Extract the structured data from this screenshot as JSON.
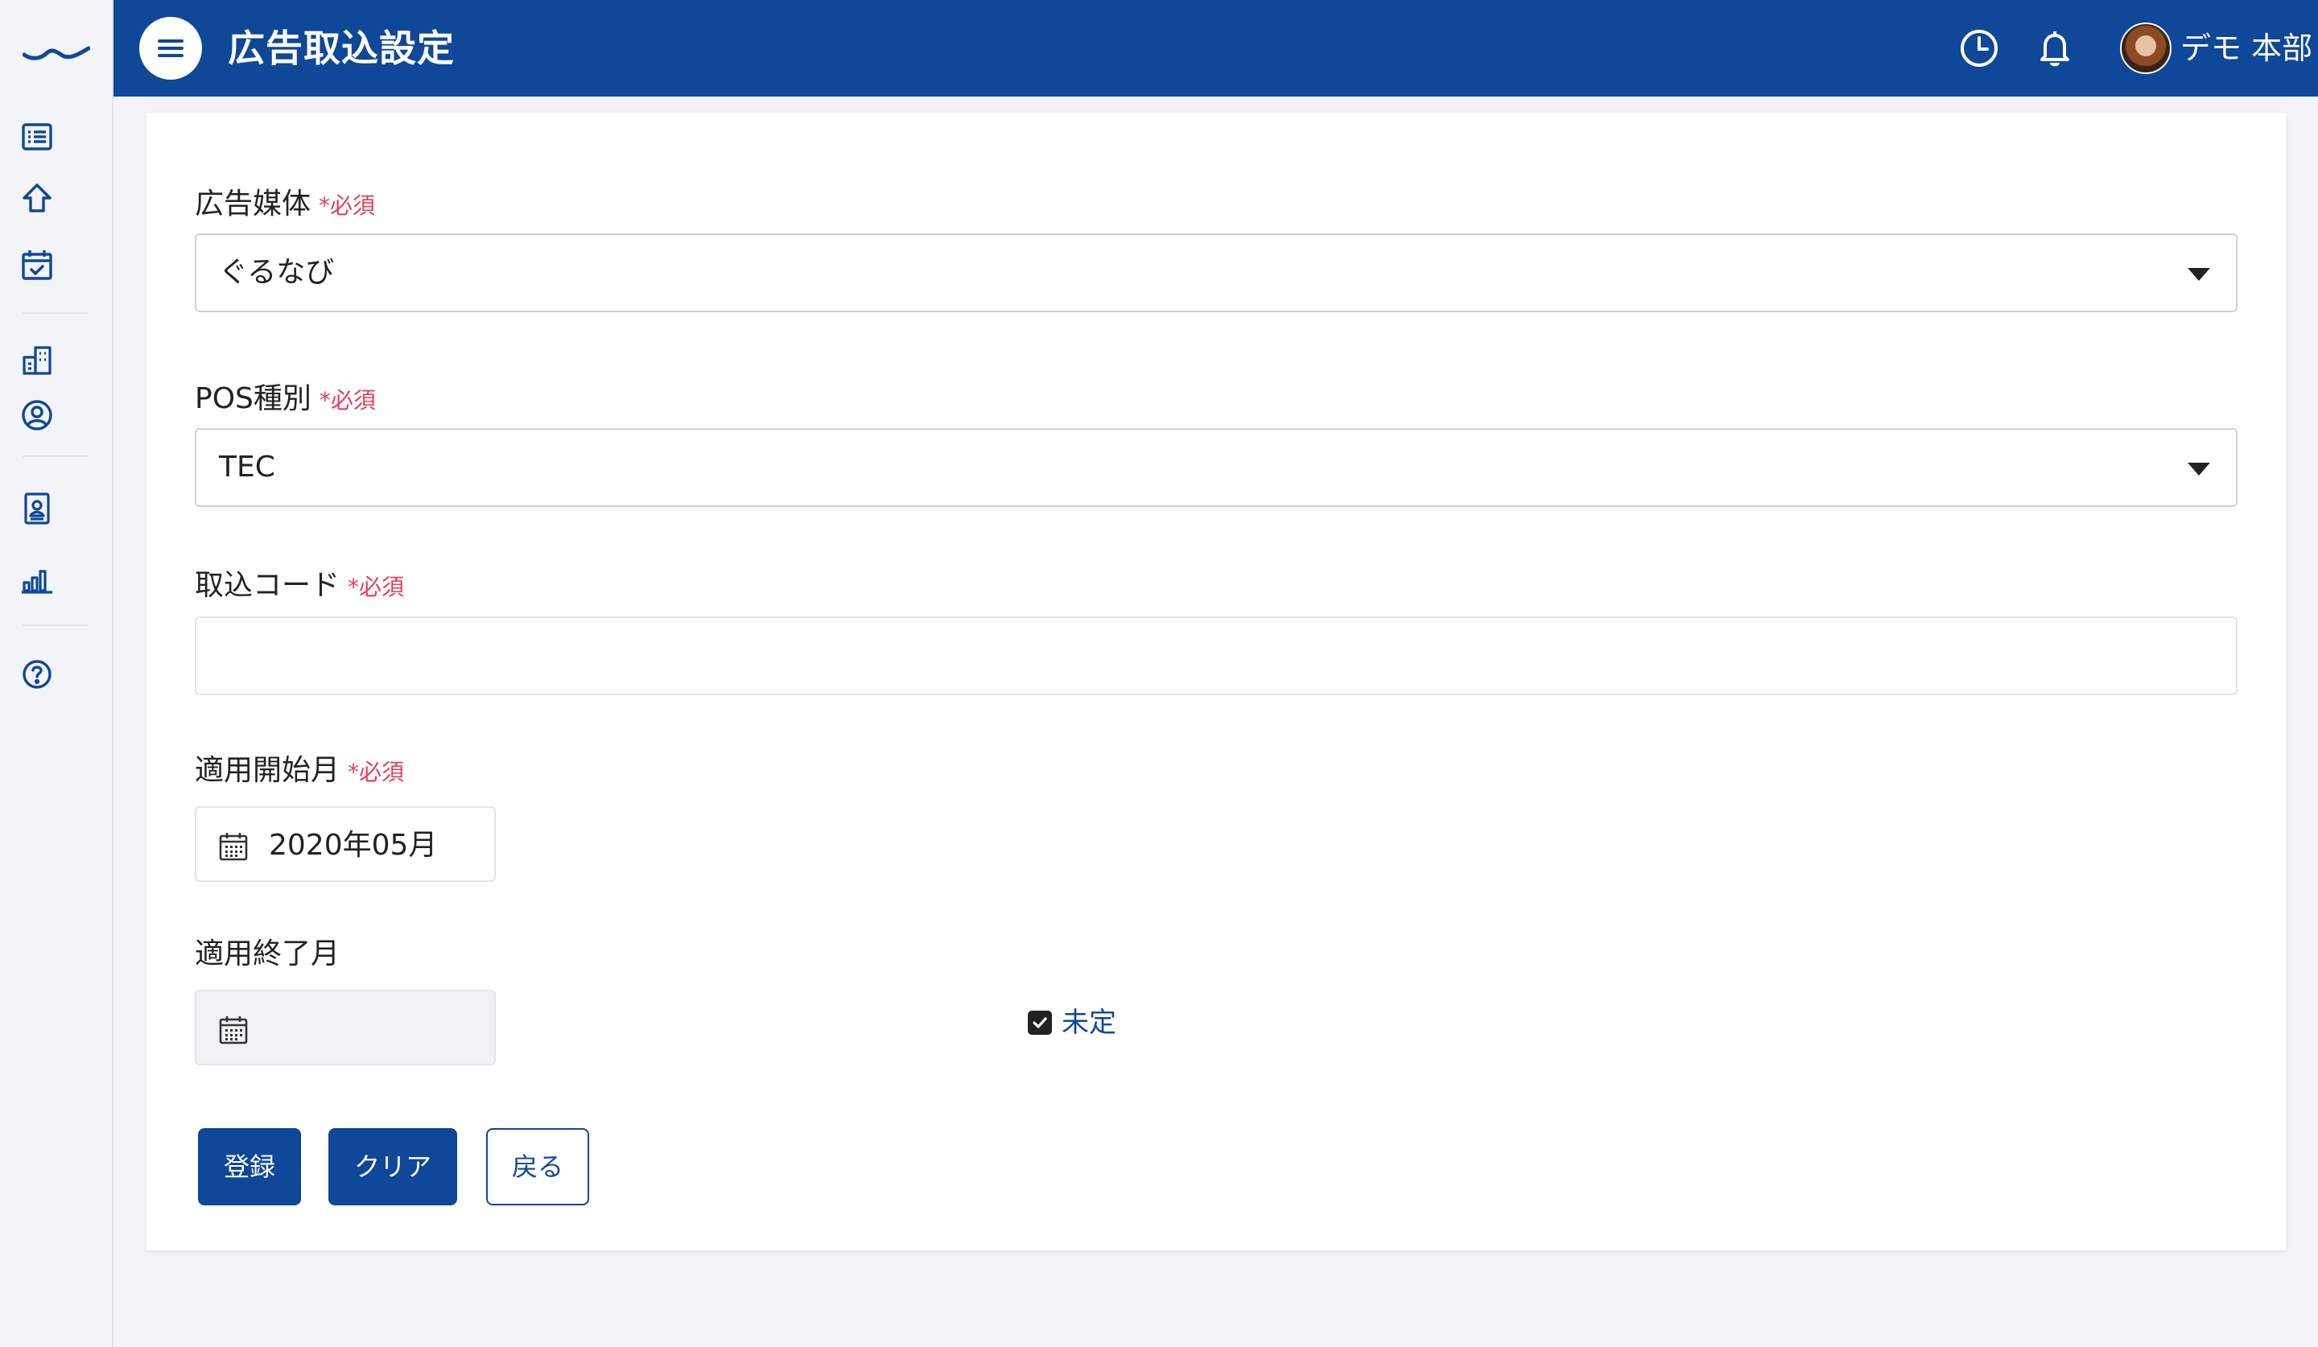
{
  "header": {
    "title": "広告取込設定",
    "user_name": "デモ 本部"
  },
  "icons": {
    "logo": "brand-wave-logo",
    "menu": "hamburger-menu-icon",
    "history": "clock-icon",
    "notifications": "bell-icon",
    "sidebar": [
      "list-icon",
      "home-icon",
      "calendar-check-icon",
      "building-icon",
      "user-circle-icon",
      "id-badge-icon",
      "bar-chart-icon",
      "help-circle-icon"
    ]
  },
  "colors": {
    "primary": "#0f4799",
    "required": "#e0405a",
    "background": "#f3f4f7"
  },
  "form": {
    "required_mark": "*必須",
    "media": {
      "label": "広告媒体",
      "value": "ぐるなび"
    },
    "pos": {
      "label": "POS種別",
      "value": "TEC"
    },
    "import_code": {
      "label": "取込コード",
      "value": ""
    },
    "start_month": {
      "label": "適用開始月",
      "value": "2020年05月"
    },
    "end_month": {
      "label": "適用終了月",
      "value": ""
    },
    "undetermined": {
      "label": "未定",
      "checked": true
    }
  },
  "buttons": {
    "register": "登録",
    "clear": "クリア",
    "back": "戻る"
  }
}
